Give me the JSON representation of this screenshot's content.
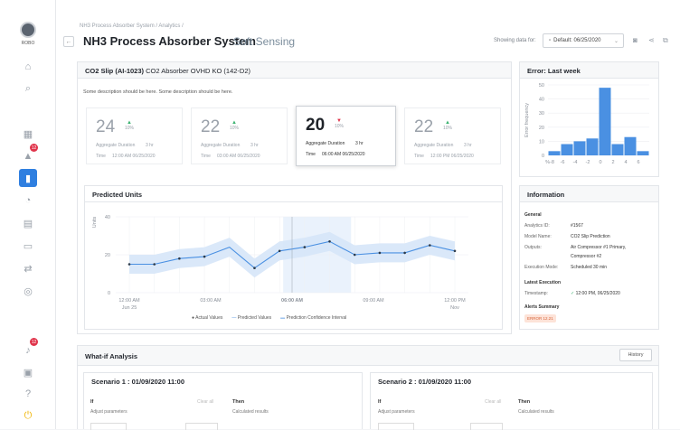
{
  "user": {
    "name": "ROBO"
  },
  "sidebar": {
    "alert_badge": "12",
    "notif_badge": "12"
  },
  "breadcrumb": {
    "root": "NH3 Process Absorber System",
    "sep": "/",
    "page": "Analytics",
    "sep2": "/"
  },
  "header": {
    "title": "NH3 Process Absorber System",
    "subtitle": "Soft Sensing",
    "showing_label": "Showing data for:",
    "date_value": "Default: 06/25/2020"
  },
  "sensor_card": {
    "title": "CO2 Slip (AI-1023)",
    "title_rest": "CO2 Absorber OVHD KO (142-D2)",
    "description": "Some description should be here. Some description should be here.",
    "kpis": [
      {
        "value": "24",
        "delta": "10%",
        "agg_label": "Aggregate Duration",
        "agg_value": "3 hr",
        "time_label": "Time",
        "time_value": "12:00 AM 06/25/2020"
      },
      {
        "value": "22",
        "delta": "10%",
        "agg_label": "Aggregate Duration",
        "agg_value": "3 hr",
        "time_label": "Time",
        "time_value": "03:00 AM 06/25/2020"
      },
      {
        "value": "20",
        "delta": "10%",
        "agg_label": "Aggregate Duration",
        "agg_value": "3 hr",
        "time_label": "Time",
        "time_value": "06:00 AM 06/25/2020"
      },
      {
        "value": "22",
        "delta": "10%",
        "agg_label": "Aggregate Duration",
        "agg_value": "3 hr",
        "time_label": "Time",
        "time_value": "12:00 PM 06/25/2020"
      }
    ]
  },
  "error_card": {
    "title": "Error: Last week"
  },
  "predicted_card": {
    "title": "Predicted Units",
    "legend": [
      "Actual Values",
      "Predicted Values",
      "Prediction Confidence Interval"
    ]
  },
  "info_card": {
    "title": "Information",
    "general": "General",
    "rows": [
      {
        "label": "Analytics ID:",
        "value": "#1567"
      },
      {
        "label": "Model Name:",
        "value": "CO2 Slip Prediction"
      },
      {
        "label": "Outputs:",
        "value": "Air Compressor #1 Primary,"
      },
      {
        "label": "",
        "value": "Compressor #2"
      },
      {
        "label": "Execution Mode:",
        "value": "Scheduled 30 min"
      }
    ],
    "latest": "Latest Execution",
    "timestamp_label": "Timestamp:",
    "timestamp_value": "12:00 PM, 06/25/2020",
    "alerts": "Alerts Summary",
    "alert_pill": "ERROR 12.21"
  },
  "whatif": {
    "title": "What-if Analysis",
    "history": "History",
    "scenarios": [
      {
        "title": "Scenario 1 : 01/09/2020 11:00",
        "if": "If",
        "adjust": "Adjust parameters",
        "clear": "Clear all",
        "then": "Then",
        "calc": "Calculated results"
      },
      {
        "title": "Scenario 2 : 01/09/2020 11:00",
        "if": "If",
        "adjust": "Adjust parameters",
        "clear": "Clear all",
        "then": "Then",
        "calc": "Calculated results"
      }
    ]
  },
  "colors": {
    "accent": "#2f7fe0",
    "bar": "#4a90e2",
    "band": "#d6e6f8"
  },
  "chart_data": [
    {
      "type": "bar",
      "title": "Error: Last week",
      "ylabel": "Error frequency",
      "categories": [
        "-8",
        "-6",
        "-4",
        "-2",
        "0",
        "2",
        "4",
        "6"
      ],
      "values": [
        3,
        8,
        10,
        12,
        48,
        8,
        13,
        3
      ],
      "xticks": [
        "%-8",
        "-6",
        "-4",
        "-2",
        "0",
        "2",
        "4",
        "6"
      ],
      "yticks": [
        "0",
        "10",
        "20",
        "30",
        "40",
        "50"
      ],
      "ylim": [
        0,
        50
      ]
    },
    {
      "type": "line",
      "title": "Predicted Units",
      "ylabel": "Units",
      "yticks": [
        "0",
        "20",
        "40"
      ],
      "ylim": [
        0,
        40
      ],
      "xticks": [
        "12:00 AM",
        "03:00 AM",
        "06:00 AM",
        "09:00 AM",
        "12:00 PM"
      ],
      "xsub": [
        "Jun 25",
        "",
        "",
        "",
        "Nov"
      ],
      "series": [
        {
          "name": "Actual Values",
          "values": [
            15,
            15,
            18,
            19,
            null,
            13,
            22,
            24,
            27,
            20,
            21,
            21,
            25,
            22
          ]
        },
        {
          "name": "Predicted Values",
          "values": [
            15,
            15,
            18,
            19,
            24,
            13,
            22,
            24,
            27,
            20,
            21,
            21,
            25,
            22
          ]
        }
      ]
    }
  ]
}
